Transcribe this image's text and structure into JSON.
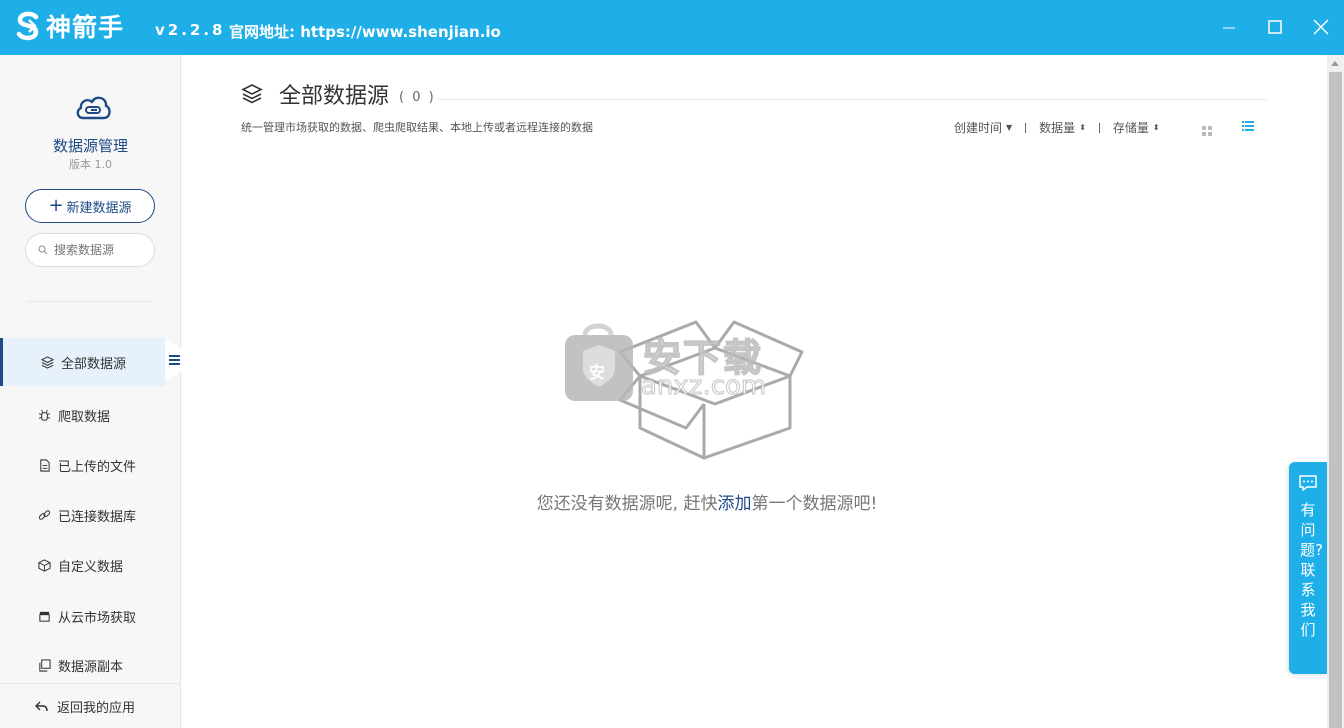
{
  "titlebar": {
    "app_name": "神箭手",
    "version": "v2.2.8",
    "website": "官网地址: https://www.shenjian.io",
    "bg_color": "#1eaee8"
  },
  "sidebar": {
    "title": "数据源管理",
    "version": "版本 1.0",
    "new_button": "新建数据源",
    "search_placeholder": "搜索数据源",
    "items": [
      {
        "label": "全部数据源",
        "icon": "layers-icon",
        "active": true
      },
      {
        "label": "爬取数据",
        "icon": "spider-icon"
      },
      {
        "label": "已上传的文件",
        "icon": "file-icon"
      },
      {
        "label": "已连接数据库",
        "icon": "link-icon"
      },
      {
        "label": "自定义数据",
        "icon": "cube-icon"
      },
      {
        "label": "从云市场获取",
        "icon": "store-icon"
      },
      {
        "label": "数据源副本",
        "icon": "copy-icon"
      }
    ],
    "back_label": "返回我的应用"
  },
  "main": {
    "title": "全部数据源",
    "count": "( 0 )",
    "subtitle": "统一管理市场获取的数据、爬虫爬取结果、本地上传或者远程连接的数据",
    "sorts": [
      "创建时间",
      "数据量",
      "存储量"
    ],
    "empty_prefix": "您还没有数据源呢, 赶快",
    "empty_link": "添加",
    "empty_suffix": "第一个数据源吧!"
  },
  "watermark": {
    "text": "安下载",
    "domain": "anxz.com",
    "badge": "安"
  },
  "help": {
    "text": "有问题?联系我们"
  },
  "colors": {
    "accent": "#1eaee8",
    "nav_text": "#1e4a88",
    "active_bg": "#e6f1fb"
  }
}
